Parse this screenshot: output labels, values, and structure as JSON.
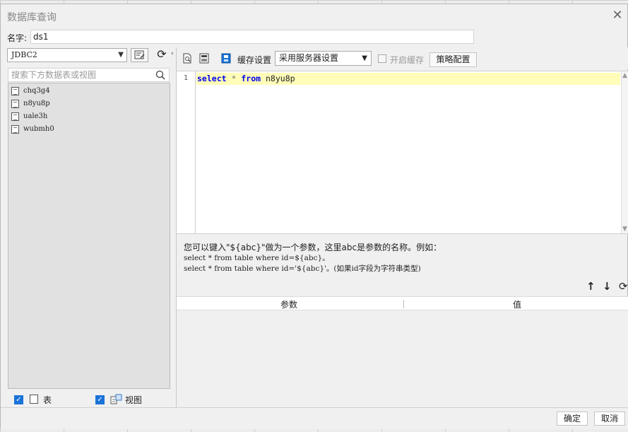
{
  "dialog": {
    "title": "数据库查询"
  },
  "name": {
    "label": "名字:",
    "value": "ds1"
  },
  "left": {
    "connection": "JDBC2",
    "search_placeholder": "搜索下方数据表或视图",
    "tables": [
      "chq3g4",
      "n8yu8p",
      "uale3h",
      "wubmh0"
    ],
    "filter_table_label": "表",
    "filter_view_label": "视图"
  },
  "toolbar": {
    "cache_settings_label": "缓存设置",
    "cache_mode": "采用服务器设置",
    "enable_cache_label": "开启缓存",
    "policy_button": "策略配置"
  },
  "editor": {
    "line_number": "1",
    "sql": {
      "kw_select": "select",
      "star": "*",
      "kw_from": "from",
      "table": "n8yu8p"
    }
  },
  "hint": {
    "line1": "您可以键入\"${abc}\"做为一个参数，这里abc是参数的名称。例如：",
    "line2": "select * from table where id=${abc}。",
    "line3": "select * from table where id='${abc}'。(如果id字段为字符串类型)"
  },
  "params": {
    "col_name": "参数",
    "col_value": "值"
  },
  "footer": {
    "ok": "确定",
    "cancel": "取消"
  },
  "colors": {
    "accent": "#1a73d8",
    "code_highlight": "#fffdb8",
    "keyword": "#0000ee"
  }
}
